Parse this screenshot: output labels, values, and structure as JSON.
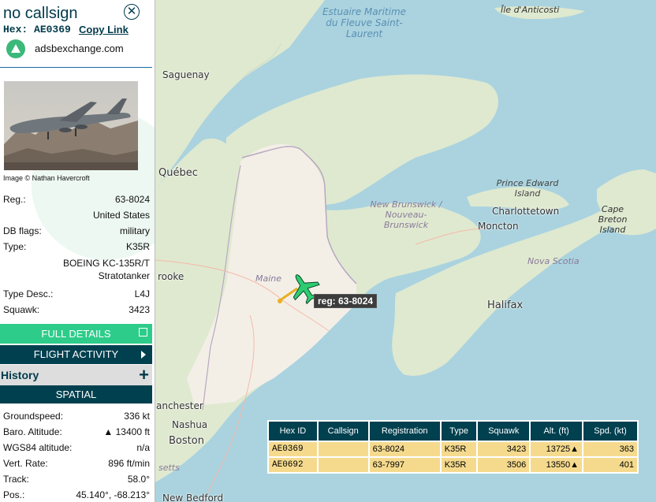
{
  "sidebar": {
    "callsign": "no callsign",
    "hex_label": "Hex:",
    "hex_value": "AE0369",
    "copy_link": "Copy Link",
    "source": "adsbexchange.com",
    "photo_credit": "Image © Nathan Havercroft",
    "fields": {
      "reg_label": "Reg.:",
      "reg_value": "63-8024",
      "country": "United States",
      "dbflags_label": "DB flags:",
      "dbflags_value": "military",
      "type_label": "Type:",
      "type_value": "K35R",
      "type_name": "BOEING KC-135R/T Stratotanker",
      "typedesc_label": "Type Desc.:",
      "typedesc_value": "L4J",
      "squawk_label": "Squawk:",
      "squawk_value": "3423"
    },
    "buttons": {
      "full_details": "FULL DETAILS",
      "flight_activity": "FLIGHT ACTIVITY",
      "history": "History",
      "spatial": "SPATIAL"
    },
    "spatial": {
      "groundspeed_label": "Groundspeed:",
      "groundspeed_value": "336 kt",
      "baro_label": "Baro. Altitude:",
      "baro_value": "▲ 13400 ft",
      "wgs_label": "WGS84 altitude:",
      "wgs_value": "n/a",
      "vert_label": "Vert. Rate:",
      "vert_value": "896 ft/min",
      "track_label": "Track:",
      "track_value": "58.0°",
      "pos_label": "Pos.:",
      "pos_value": "45.140°, -68.213°"
    }
  },
  "map": {
    "labels": {
      "estuaire": "Estuaire Maritime du Fleuve Saint-Laurent",
      "anticosti": "Île d'Anticosti",
      "saguenay": "Saguenay",
      "quebec": "Québec",
      "pei": "Prince Edward Island",
      "charlottetown": "Charlottetown",
      "capebreton": "Cape Breton Island",
      "newbrunswick": "New Brunswick / Nouveau-Brunswick",
      "moncton": "Moncton",
      "novascotia": "Nova Scotia",
      "halifax": "Halifax",
      "maine": "Maine",
      "brooke": "rooke",
      "manchester": "anchester",
      "nashua": "Nashua",
      "boston": "Boston",
      "setts": "setts",
      "newbedford": "New Bedford"
    },
    "reg_tag": "reg: 63-8024",
    "colors": {
      "aircraft": "#2ecc71",
      "trail": "#e8b020",
      "water": "#aad3df",
      "land": "#f2efe9"
    }
  },
  "table": {
    "headers": [
      "Hex ID",
      "Callsign",
      "Registration",
      "Type",
      "Squawk",
      "Alt. (ft)",
      "Spd. (kt)"
    ],
    "rows": [
      {
        "hex": "AE0369",
        "callsign": "",
        "reg": "63-8024",
        "type": "K35R",
        "squawk": "3423",
        "alt": "13725▲",
        "spd": "363"
      },
      {
        "hex": "AE0692",
        "callsign": "",
        "reg": "63-7997",
        "type": "K35R",
        "squawk": "3506",
        "alt": "13550▲",
        "spd": "401"
      }
    ]
  }
}
